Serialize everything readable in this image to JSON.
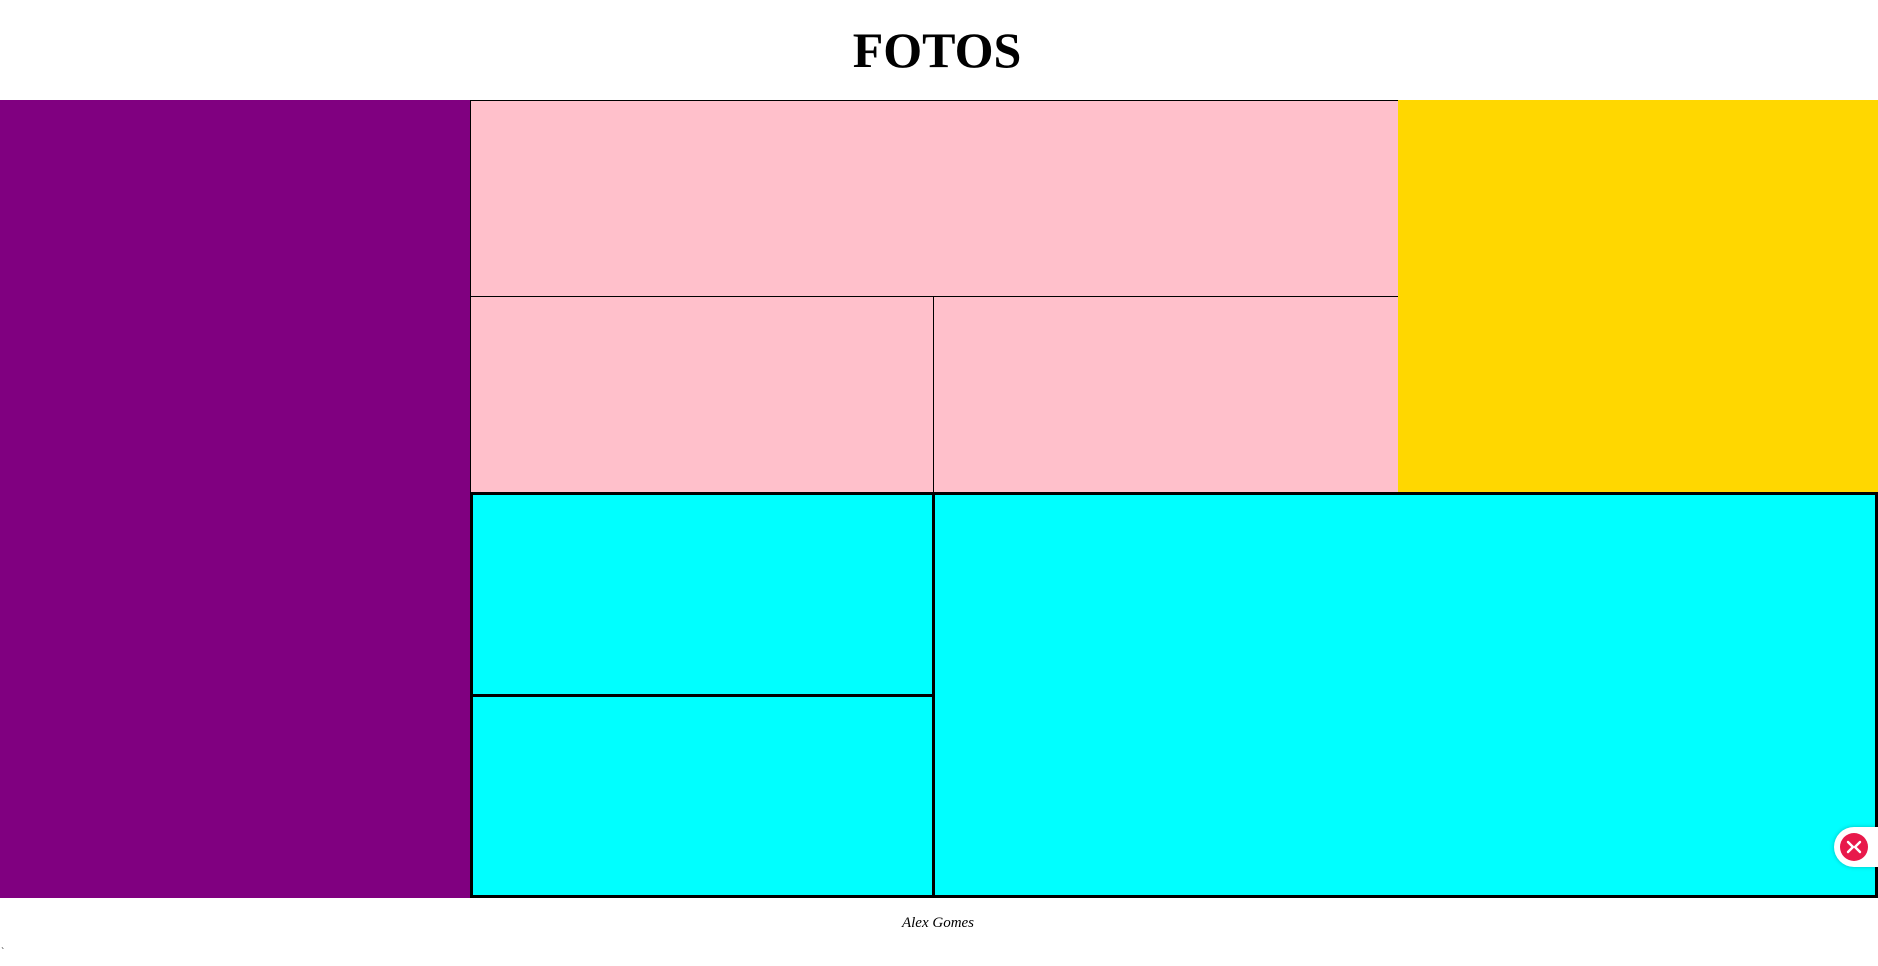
{
  "header": {
    "title": "FOTOS"
  },
  "gallery": {
    "tiles": [
      {
        "name": "photo-tile-left",
        "color": "#800080"
      },
      {
        "name": "photo-tile-top-wide",
        "color": "#ffc0cb"
      },
      {
        "name": "photo-tile-middle-left",
        "color": "#ffc0cb"
      },
      {
        "name": "photo-tile-middle-right",
        "color": "#ffc0cb"
      },
      {
        "name": "photo-tile-right",
        "color": "#ffd700"
      },
      {
        "name": "photo-tile-lower-left-top",
        "color": "#00ffff"
      },
      {
        "name": "photo-tile-lower-left-bottom",
        "color": "#00ffff"
      },
      {
        "name": "photo-tile-lower-right-large",
        "color": "#00ffff"
      }
    ]
  },
  "footer": {
    "author": "Alex Gomes"
  },
  "stray_mark": "`",
  "floating_control": {
    "icon": "collapse-arrows-icon",
    "color": "#e8194b"
  }
}
